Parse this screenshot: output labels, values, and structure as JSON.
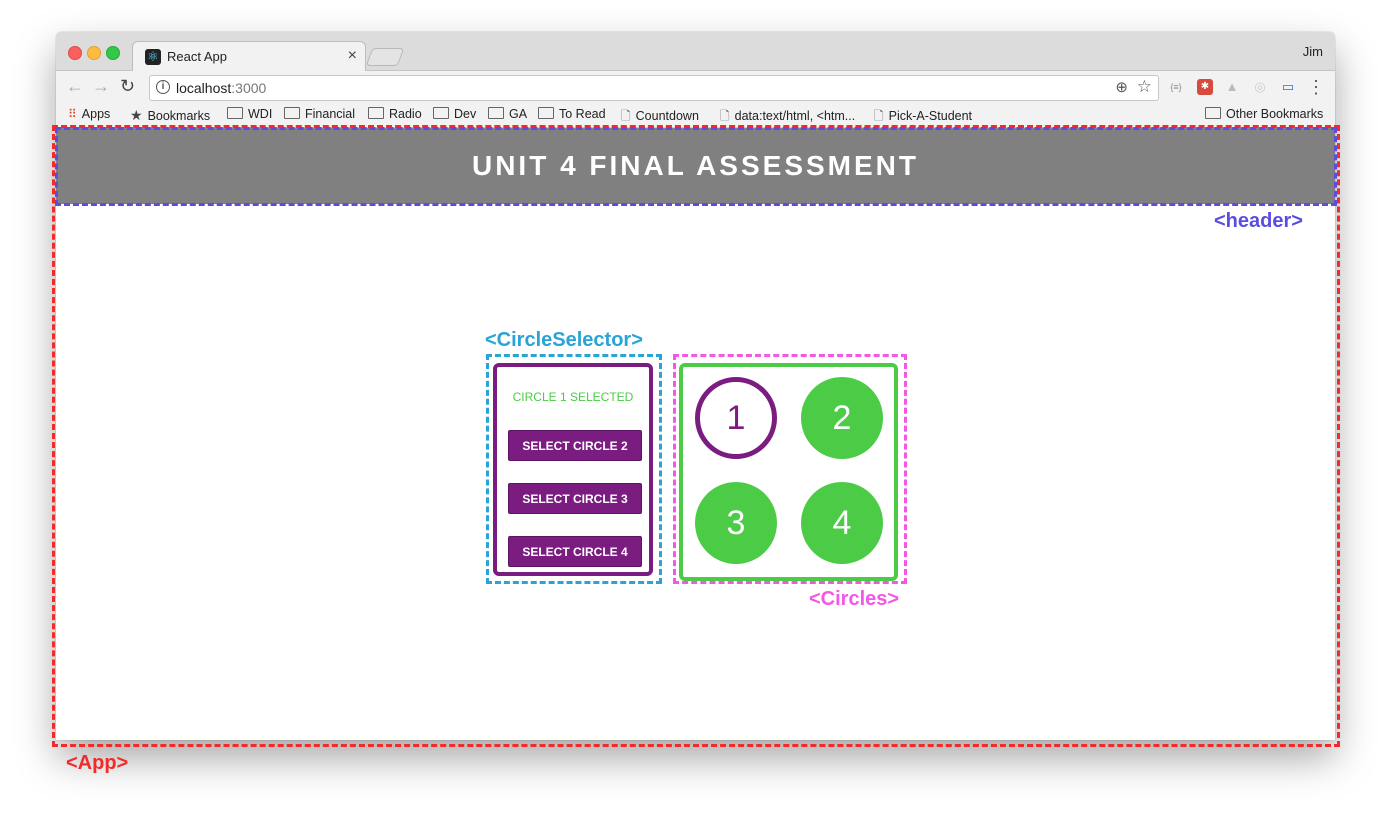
{
  "browser": {
    "tab_title": "React App",
    "tab_close": "×",
    "user": "Jim",
    "url_host": "localhost",
    "url_port": ":3000",
    "bookmarks": [
      {
        "label": "Apps",
        "icon": "apps-grid-icon"
      },
      {
        "label": "Bookmarks",
        "icon": "star-icon"
      },
      {
        "label": "WDI",
        "icon": "folder-icon"
      },
      {
        "label": "Financial",
        "icon": "folder-icon"
      },
      {
        "label": "Radio",
        "icon": "folder-icon"
      },
      {
        "label": "Dev",
        "icon": "folder-icon"
      },
      {
        "label": "GA",
        "icon": "folder-icon"
      },
      {
        "label": "To Read",
        "icon": "folder-icon"
      },
      {
        "label": "Countdown",
        "icon": "page-icon"
      },
      {
        "label": "data:text/html, <htm...",
        "icon": "page-icon"
      },
      {
        "label": "Pick-A-Student",
        "icon": "page-icon"
      }
    ],
    "other_bookmarks": "Other Bookmarks"
  },
  "app": {
    "header_title": "UNIT 4 FINAL ASSESSMENT",
    "selector": {
      "status": "CIRCLE 1 SELECTED",
      "buttons": [
        "SELECT CIRCLE 2",
        "SELECT CIRCLE 3",
        "SELECT CIRCLE 4"
      ]
    },
    "circles": [
      "1",
      "2",
      "3",
      "4"
    ],
    "selected_circle": "1"
  },
  "annotations": {
    "header": "<header>",
    "circle_selector": "<CircleSelector>",
    "circles": "<Circles>",
    "app": "<App>"
  },
  "colors": {
    "header_bg": "#808080",
    "purple": "#7b1c80",
    "green": "#4ccb47",
    "annotation_header": "#5b4de0",
    "annotation_selector": "#2aa3d6",
    "annotation_circles": "#f257e6",
    "annotation_app": "#f22a2a"
  }
}
